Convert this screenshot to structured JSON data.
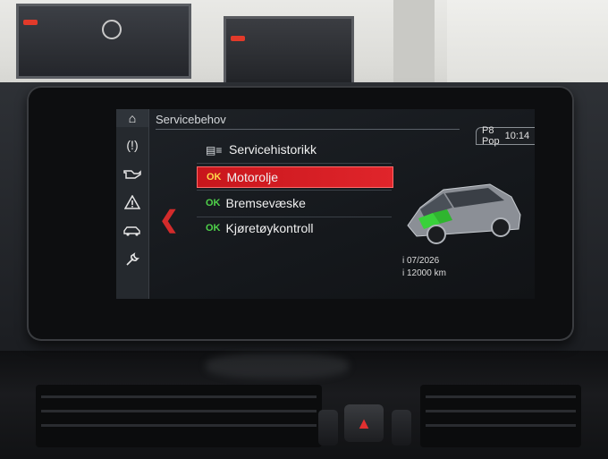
{
  "screen": {
    "title": "Servicebehov",
    "status": {
      "station": "P8 Pop",
      "time": "10:14"
    },
    "menu": [
      {
        "label": "Servicehistorikk",
        "status": "",
        "selected": false
      },
      {
        "label": "Motorolje",
        "status": "OK",
        "selected": true
      },
      {
        "label": "Bremsevæske",
        "status": "OK",
        "selected": false
      },
      {
        "label": "Kjøretøykontroll",
        "status": "OK",
        "selected": false
      }
    ],
    "due": {
      "date": "i 07/2026",
      "distance": "i 12000 km"
    }
  },
  "icons": [
    "home-icon",
    "tire-pressure-icon",
    "oil-can-icon",
    "warning-triangle-icon",
    "car-icon",
    "service-wrench-icon",
    "back-chevron-icon",
    "service-history-icon"
  ],
  "colors": {
    "selection": "#d81e24",
    "ok_green": "#4fd24a",
    "ok_selected": "#ffd84a"
  }
}
